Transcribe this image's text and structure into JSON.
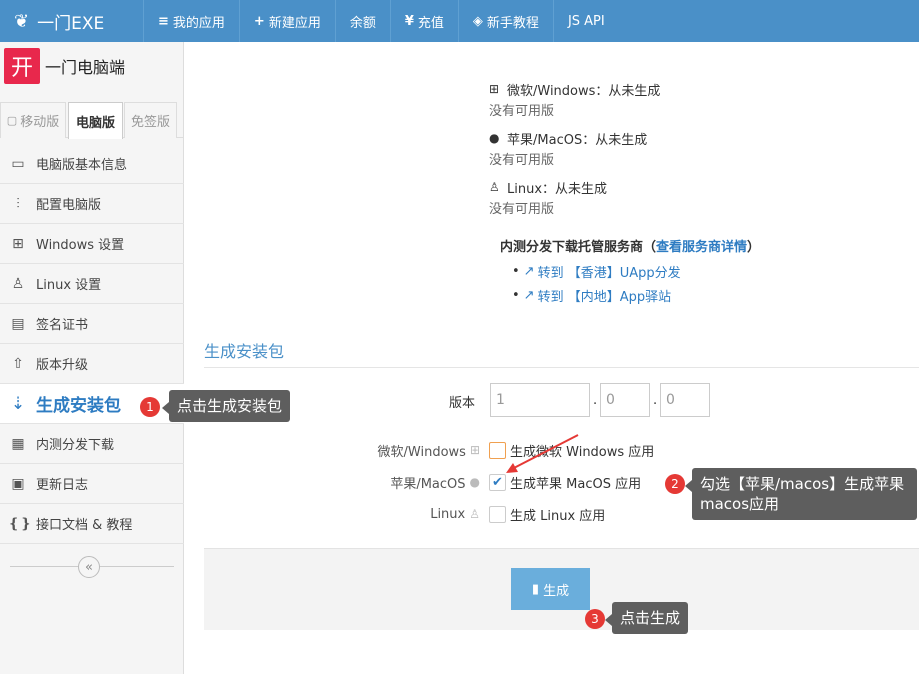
{
  "topnav": {
    "brand": "一门EXE",
    "items": [
      {
        "icon": "≡",
        "label": "我的应用"
      },
      {
        "icon": "+",
        "label": "新建应用"
      },
      {
        "icon": "",
        "label": "余额"
      },
      {
        "icon": "¥",
        "label": "充值"
      },
      {
        "icon": "◈",
        "label": "新手教程"
      },
      {
        "icon": "",
        "label": "JS API"
      }
    ]
  },
  "sidebar": {
    "app_logo": "开",
    "app_name": "一门电脑端",
    "tabs": [
      "移动版",
      "电脑版",
      "免签版"
    ],
    "menu": [
      {
        "icon": "monitor-icon",
        "label": "电脑版基本信息"
      },
      {
        "icon": "sliders-icon",
        "label": "配置电脑版"
      },
      {
        "icon": "windows-icon",
        "label": "Windows 设置"
      },
      {
        "icon": "linux-icon",
        "label": "Linux 设置"
      },
      {
        "icon": "certificate-icon",
        "label": "签名证书"
      },
      {
        "icon": "upgrade-icon",
        "label": "版本升级"
      },
      {
        "icon": "sort-icon",
        "label": "生成安装包"
      },
      {
        "icon": "qrcode-icon",
        "label": "内测分发下载"
      },
      {
        "icon": "calendar-icon",
        "label": "更新日志"
      },
      {
        "icon": "code-file-icon",
        "label": "接口文档 & 教程"
      }
    ],
    "active_index": 6
  },
  "main": {
    "os_status": [
      {
        "title": "微软/Windows：从未生成",
        "sub": "没有可用版"
      },
      {
        "title": "苹果/MacOS：从未生成",
        "sub": "没有可用版"
      },
      {
        "title": "Linux：从未生成",
        "sub": "没有可用版"
      }
    ],
    "hosting_title": "内测分发下载托管服务商",
    "hosting_link": "查看服务商详情",
    "hosting_links": [
      "转到 【香港】UApp分发",
      "转到 【内地】App驿站"
    ],
    "section_title": "生成安装包",
    "version_label": "版本",
    "version": [
      "1",
      "0",
      "0"
    ],
    "options": [
      {
        "label": "微软/Windows",
        "text": "生成微软 Windows 应用",
        "checked": false
      },
      {
        "label": "苹果/MacOS",
        "text": "生成苹果 MacOS 应用",
        "checked": true
      },
      {
        "label": "Linux",
        "text": "生成 Linux 应用",
        "checked": false
      }
    ],
    "generate_label": "生成"
  },
  "callouts": [
    {
      "num": "1",
      "text": "点击生成安装包"
    },
    {
      "num": "2",
      "text": "勾选【苹果/macos】生成苹果macos应用"
    },
    {
      "num": "3",
      "text": "点击生成"
    }
  ],
  "colors": {
    "nav": "#4a90c8",
    "accent": "#2e7cc2",
    "badge": "#e53935",
    "callout": "#5e5e5e"
  }
}
